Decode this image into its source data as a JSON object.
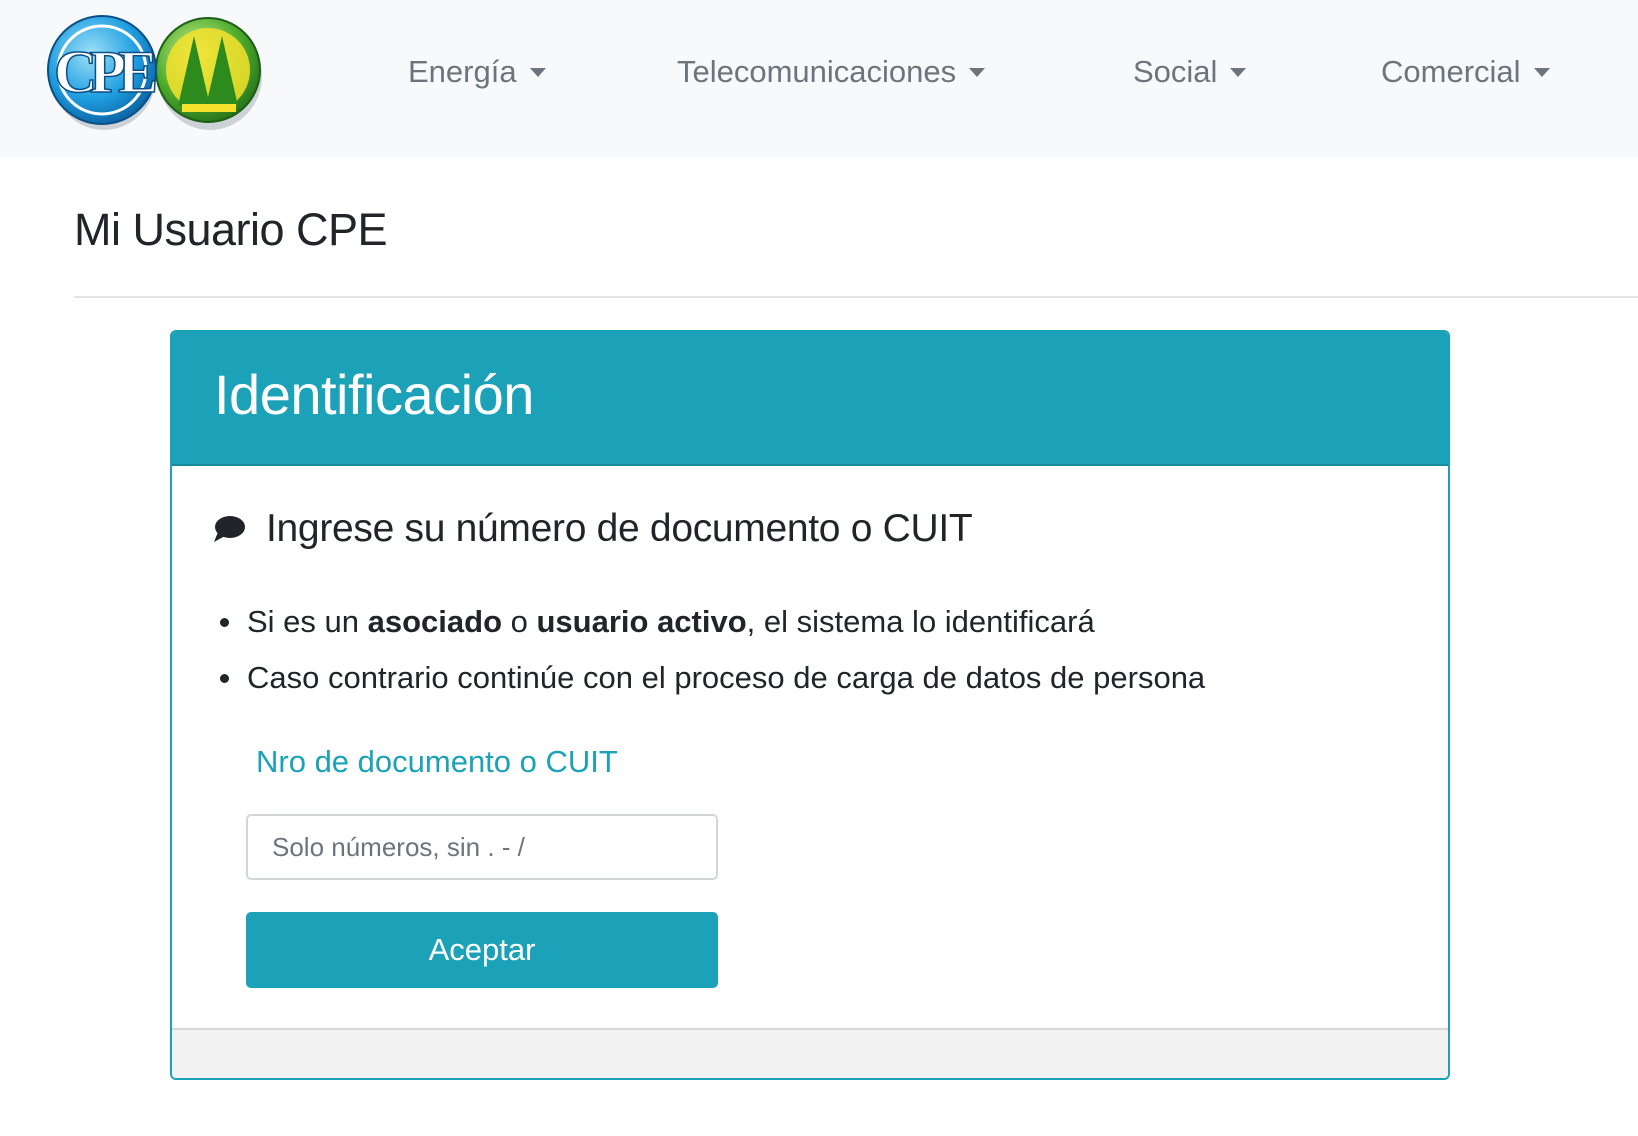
{
  "navbar": {
    "logo_text": "CPE",
    "items": [
      {
        "label": "Energía"
      },
      {
        "label": "Telecomunicaciones"
      },
      {
        "label": "Social"
      },
      {
        "label": "Comercial"
      }
    ]
  },
  "page": {
    "title": "Mi Usuario CPE"
  },
  "card": {
    "header_title": "Identificación",
    "section_heading": "Ingrese su número de documento o CUIT",
    "bullet1": {
      "text_a": "Si es un ",
      "bold_a": "asociado",
      "text_b": " o ",
      "bold_b": "usuario activo",
      "text_c": ", el sistema lo identificará"
    },
    "bullet2": {
      "text": "Caso contrario continúe con el proceso de carga de datos de persona"
    },
    "field_label": "Nro de documento o CUIT",
    "input_placeholder": "Solo números, sin . - /",
    "input_value": "",
    "button_label": "Aceptar"
  },
  "colors": {
    "accent": "#1ca2b8",
    "navbar_bg": "#f8f9fa",
    "nav_text": "#6c757d"
  },
  "icons": [
    "cpe-logo",
    "green-seal-logo",
    "comment-icon",
    "caret-down-icon"
  ]
}
